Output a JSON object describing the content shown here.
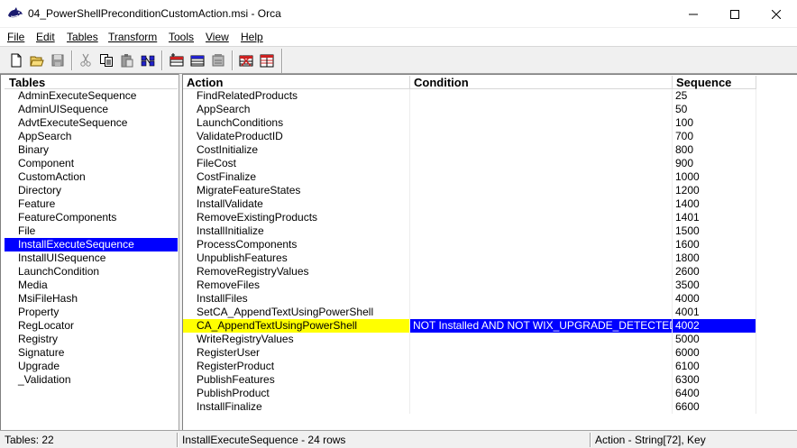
{
  "window": {
    "title": "04_PowerShellPreconditionCustomAction.msi - Orca",
    "icon": "orca-app-icon"
  },
  "menu": [
    "File",
    "Edit",
    "Tables",
    "Transform",
    "Tools",
    "View",
    "Help"
  ],
  "toolbar": {
    "icons": [
      "new-file-icon",
      "open-folder-icon",
      "save-icon",
      "cut-icon",
      "copy-icon",
      "paste-icon",
      "find-icon",
      "add-row-icon",
      "drop-row-icon",
      "tables-icon",
      "validate-icon",
      "merge-module-icon"
    ]
  },
  "tables_pane": {
    "header": "Tables",
    "items": [
      "AdminExecuteSequence",
      "AdminUISequence",
      "AdvtExecuteSequence",
      "AppSearch",
      "Binary",
      "Component",
      "CustomAction",
      "Directory",
      "Feature",
      "FeatureComponents",
      "File",
      "InstallExecuteSequence",
      "InstallUISequence",
      "LaunchCondition",
      "Media",
      "MsiFileHash",
      "Property",
      "RegLocator",
      "Registry",
      "Signature",
      "Upgrade",
      "_Validation"
    ],
    "selected_index": 11
  },
  "grid": {
    "columns": [
      "Action",
      "Condition",
      "Sequence"
    ],
    "rows": [
      {
        "action": "FindRelatedProducts",
        "condition": "",
        "sequence": "25"
      },
      {
        "action": "AppSearch",
        "condition": "",
        "sequence": "50"
      },
      {
        "action": "LaunchConditions",
        "condition": "",
        "sequence": "100"
      },
      {
        "action": "ValidateProductID",
        "condition": "",
        "sequence": "700"
      },
      {
        "action": "CostInitialize",
        "condition": "",
        "sequence": "800"
      },
      {
        "action": "FileCost",
        "condition": "",
        "sequence": "900"
      },
      {
        "action": "CostFinalize",
        "condition": "",
        "sequence": "1000"
      },
      {
        "action": "MigrateFeatureStates",
        "condition": "",
        "sequence": "1200"
      },
      {
        "action": "InstallValidate",
        "condition": "",
        "sequence": "1400"
      },
      {
        "action": "RemoveExistingProducts",
        "condition": "",
        "sequence": "1401"
      },
      {
        "action": "InstallInitialize",
        "condition": "",
        "sequence": "1500"
      },
      {
        "action": "ProcessComponents",
        "condition": "",
        "sequence": "1600"
      },
      {
        "action": "UnpublishFeatures",
        "condition": "",
        "sequence": "1800"
      },
      {
        "action": "RemoveRegistryValues",
        "condition": "",
        "sequence": "2600"
      },
      {
        "action": "RemoveFiles",
        "condition": "",
        "sequence": "3500"
      },
      {
        "action": "InstallFiles",
        "condition": "",
        "sequence": "4000"
      },
      {
        "action": "SetCA_AppendTextUsingPowerShell",
        "condition": "",
        "sequence": "4001"
      },
      {
        "action": "CA_AppendTextUsingPowerShell",
        "condition": "NOT Installed AND NOT WIX_UPGRADE_DETECTED",
        "sequence": "4002"
      },
      {
        "action": "WriteRegistryValues",
        "condition": "",
        "sequence": "5000"
      },
      {
        "action": "RegisterUser",
        "condition": "",
        "sequence": "6000"
      },
      {
        "action": "RegisterProduct",
        "condition": "",
        "sequence": "6100"
      },
      {
        "action": "PublishFeatures",
        "condition": "",
        "sequence": "6300"
      },
      {
        "action": "PublishProduct",
        "condition": "",
        "sequence": "6400"
      },
      {
        "action": "InstallFinalize",
        "condition": "",
        "sequence": "6600"
      }
    ],
    "highlight_index": 17
  },
  "statusbar": {
    "tables_count": "Tables: 22",
    "rows_info": "InstallExecuteSequence - 24 rows",
    "column_info": "Action - String[72], Key"
  },
  "colors": {
    "selection": "#0000ff",
    "highlight": "#ffff00"
  }
}
